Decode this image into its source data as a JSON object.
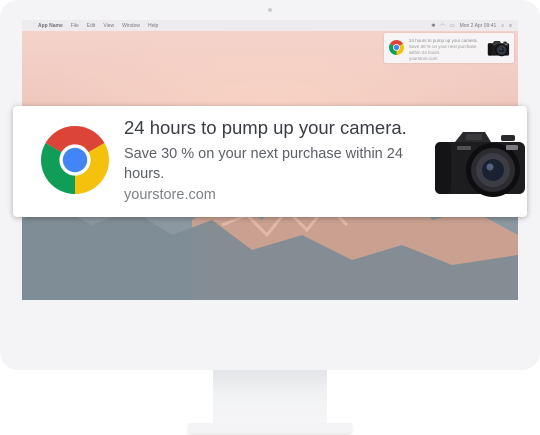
{
  "menubar": {
    "apple_glyph": "",
    "items": [
      "App Name",
      "File",
      "Edit",
      "View",
      "Window",
      "Help"
    ],
    "clock": "Mon 2 Apr 09:41"
  },
  "mini_notification": {
    "title": "24 hours to pump up your camera.",
    "message": "Save 30 % on your next purchase within 24 hours.",
    "site": "yourstore.com"
  },
  "notification": {
    "title": "24 hours to pump up your camera.",
    "message": "Save 30 % on your next purchase within 24 hours.",
    "site": "yourstore.com",
    "icon": "chrome-logo-icon",
    "image": "camera-image"
  },
  "colors": {
    "chrome_red": "#db4437",
    "chrome_yellow": "#f4c20d",
    "chrome_green": "#0f9d58",
    "chrome_blue": "#4285f4"
  }
}
